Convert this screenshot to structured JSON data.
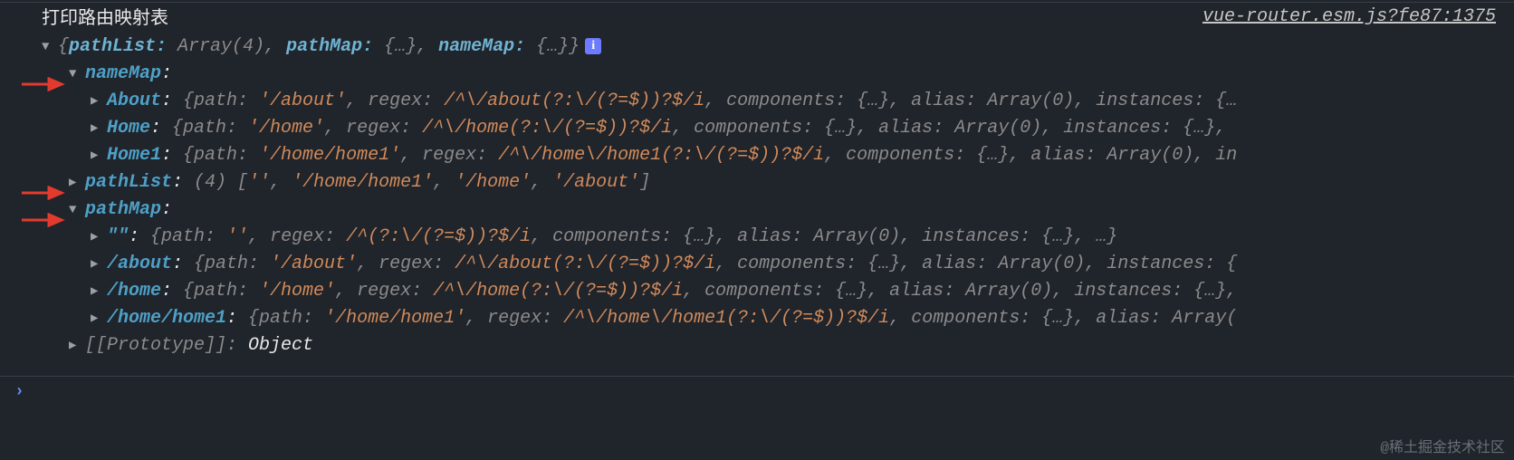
{
  "sourceLink": "vue-router.esm.js?fe87:1375",
  "logMessage": "打印路由映射表",
  "summary": {
    "open": "{",
    "pathListLabel": "pathList:",
    "pathListVal": " Array(4)",
    "sep1": ", ",
    "pathMapLabel": "pathMap:",
    "pathMapVal": " {…}",
    "sep2": ", ",
    "nameMapLabel": "nameMap:",
    "nameMapVal": " {…}",
    "close": "}"
  },
  "nameMap": {
    "label": "nameMap",
    "entries": [
      {
        "key": "About",
        "path": "'/about'",
        "regex": "/^\\/about(?:\\/(?=$))?$/i",
        "tail": ", components: {…}, alias: Array(0), instances: {…"
      },
      {
        "key": "Home",
        "path": "'/home'",
        "regex": "/^\\/home(?:\\/(?=$))?$/i",
        "tail": ", components: {…}, alias: Array(0), instances: {…},"
      },
      {
        "key": "Home1",
        "path": "'/home/home1'",
        "regex": "/^\\/home\\/home1(?:\\/(?=$))?$/i",
        "tail": ", components: {…}, alias: Array(0), in"
      }
    ]
  },
  "pathList": {
    "label": "pathList",
    "count": "(4)",
    "items": [
      "''",
      "'/home/home1'",
      "'/home'",
      "'/about'"
    ]
  },
  "pathMap": {
    "label": "pathMap",
    "entries": [
      {
        "key": "\"\"",
        "path": "''",
        "regex": "/^(?:\\/(?=$))?$/i",
        "tail": ", components: {…}, alias: Array(0), instances: {…}, …}"
      },
      {
        "key": "/about",
        "path": "'/about'",
        "regex": "/^\\/about(?:\\/(?=$))?$/i",
        "tail": ", components: {…}, alias: Array(0), instances: {"
      },
      {
        "key": "/home",
        "path": "'/home'",
        "regex": "/^\\/home(?:\\/(?=$))?$/i",
        "tail": ", components: {…}, alias: Array(0), instances: {…},"
      },
      {
        "key": "/home/home1",
        "path": "'/home/home1'",
        "regex": "/^\\/home\\/home1(?:\\/(?=$))?$/i",
        "tail": ", components: {…}, alias: Array("
      }
    ]
  },
  "prototype": {
    "label": "[[Prototype]]",
    "value": "Object"
  },
  "prompt": "›",
  "watermark": "@稀土掘金技术社区"
}
